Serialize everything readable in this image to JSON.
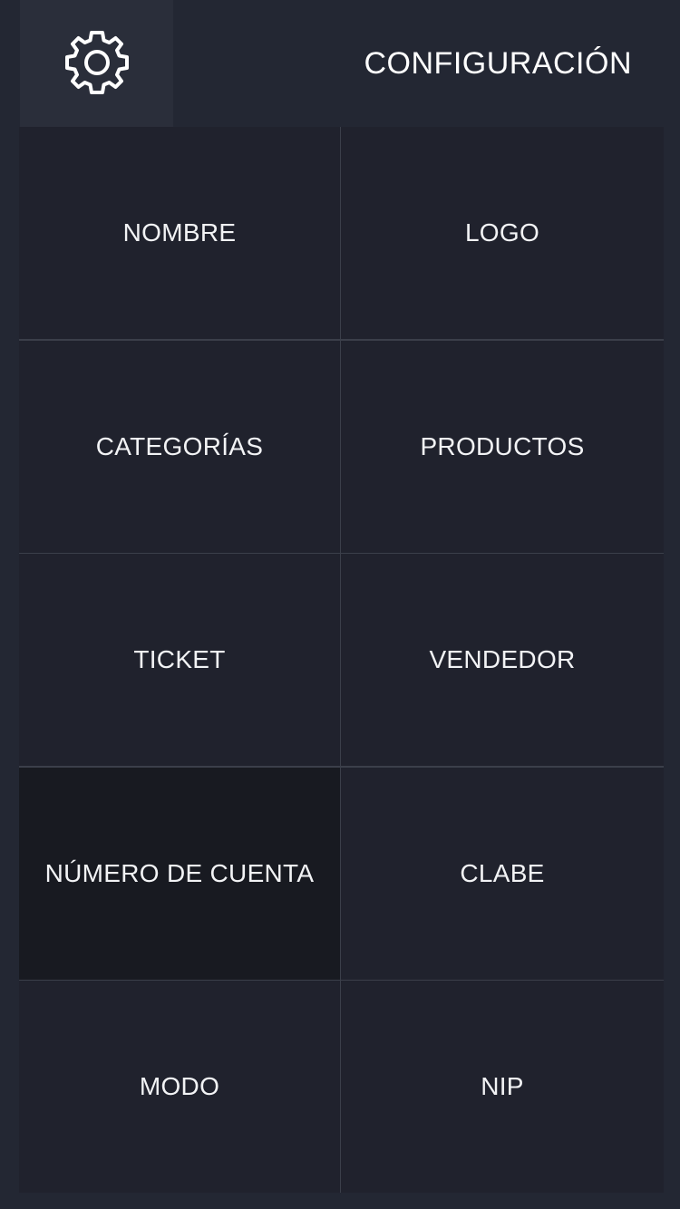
{
  "header": {
    "title": "CONFIGURACIÓN",
    "settings_icon": "gear-icon"
  },
  "menu": {
    "items": [
      {
        "label": "NOMBRE",
        "name": "nombre"
      },
      {
        "label": "LOGO",
        "name": "logo"
      },
      {
        "label": "CATEGORÍAS",
        "name": "categorias"
      },
      {
        "label": "PRODUCTOS",
        "name": "productos"
      },
      {
        "label": "TICKET",
        "name": "ticket"
      },
      {
        "label": "VENDEDOR",
        "name": "vendedor"
      },
      {
        "label": "NÚMERO DE CUENTA",
        "name": "numero-de-cuenta",
        "active": true
      },
      {
        "label": "CLABE",
        "name": "clabe"
      },
      {
        "label": "MODO",
        "name": "modo"
      },
      {
        "label": "NIP",
        "name": "nip"
      }
    ]
  },
  "colors": {
    "background": "#232733",
    "cell": "#20222d",
    "cell_active": "#181a21",
    "settings_button": "#2a2e3a",
    "text": "#ffffff"
  }
}
